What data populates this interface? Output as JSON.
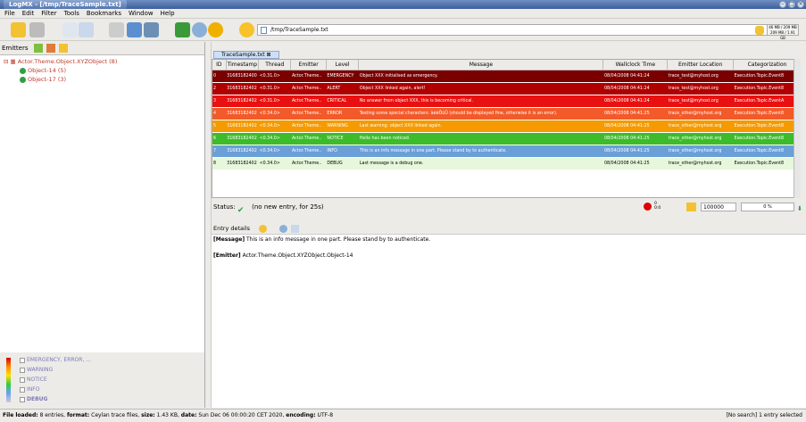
{
  "window": {
    "title": "LogMX - [/tmp/TraceSample.txt]"
  },
  "menu": [
    "File",
    "Edit",
    "Filter",
    "Tools",
    "Bookmarks",
    "Window",
    "Help"
  ],
  "toolbar": {
    "path": "/tmp/TraceSample.txt",
    "mem_used": "46 MB / 209 MB",
    "mem_total": "209 MB / 1.91 GB"
  },
  "emitters": {
    "label": "Emitters",
    "root": "Actor.Theme.Object.XYZObject (8)",
    "children": [
      "Object-14 (5)",
      "Object-17 (3)"
    ]
  },
  "levels": [
    "EMERGENCY, ERROR, ...",
    "WARNING",
    "NOTICE",
    "INFO",
    "DEBUG"
  ],
  "tab": {
    "label": "TraceSample.txt"
  },
  "table": {
    "columns": [
      "ID",
      "Timestamp",
      "Thread",
      "Emitter",
      "Level",
      "Message",
      "Wallclock Time",
      "Emitter Location",
      "Categorization"
    ],
    "rows": [
      {
        "id": "0",
        "ts": "31683182400",
        "thread": "<0.31.0>",
        "emitter": "Actor.Theme..",
        "level": "EMERGENCY",
        "msg": "Object XXX initialised as emergency.",
        "wall": "08/04/2008 04:41:24",
        "loc": "trace_test@myhost.org",
        "cat": "Execution.Topic.Event8",
        "bg": "#7a0000"
      },
      {
        "id": "2",
        "ts": "31683182402",
        "thread": "<0.31.0>",
        "emitter": "Actor.Theme..",
        "level": "ALERT",
        "msg": "Object XXX linked again, alert!",
        "wall": "08/04/2008 04:41:24",
        "loc": "trace_test@myhost.org",
        "cat": "Execution.Topic.Event8",
        "bg": "#b00000"
      },
      {
        "id": "3",
        "ts": "31683182402",
        "thread": "<0.31.0>",
        "emitter": "Actor.Theme..",
        "level": "CRITICAL",
        "msg": "No answer from object XXX, this is becoming critical.",
        "wall": "08/04/2008 04:41:24",
        "loc": "trace_test@myhost.org",
        "cat": "Execution.Topic.EventA",
        "bg": "#e81010"
      },
      {
        "id": "4",
        "ts": "31683182402",
        "thread": "<0.34.0>",
        "emitter": "Actor.Theme..",
        "level": "ERROR",
        "msg": "Testing some special characters: àéèÖüÜ (should be displayed fine, otherwise it is an error).",
        "wall": "08/04/2008 04:41:25",
        "loc": "trace_other@myhost.org",
        "cat": "Execution.Topic.Event8",
        "bg": "#f25a2a"
      },
      {
        "id": "5",
        "ts": "31683182402",
        "thread": "<0.34.0>",
        "emitter": "Actor.Theme..",
        "level": "WARNING",
        "msg": "Last warning: object XXX linked again.",
        "wall": "08/04/2008 04:41:25",
        "loc": "trace_other@myhost.org",
        "cat": "Execution.Topic.Event8",
        "bg": "#f59a00"
      },
      {
        "id": "6",
        "ts": "31683182402",
        "thread": "<0.34.0>",
        "emitter": "Actor.Theme..",
        "level": "NOTICE",
        "msg": "Hello has been noticed.",
        "wall": "08/04/2008 04:41:25",
        "loc": "trace_other@myhost.org",
        "cat": "Execution.Topic.Event8",
        "bg": "#3dbb2a"
      },
      {
        "id": "7",
        "ts": "31683182402",
        "thread": "<0.34.0>",
        "emitter": "Actor.Theme..",
        "level": "INFO",
        "msg": "This is an info message in one part. Please stand by to authenticate.",
        "wall": "08/04/2008 04:41:25",
        "loc": "trace_other@myhost.org",
        "cat": "Execution.Topic.Event8",
        "bg": "#6a9fd8"
      },
      {
        "id": "8",
        "ts": "31683182402",
        "thread": "<0.34.0>",
        "emitter": "Actor.Theme..",
        "level": "DEBUG",
        "msg": "Last message is a debug one.",
        "wall": "08/04/2008 04:41:25",
        "loc": "trace_other@myhost.org",
        "cat": "Execution.Topic.Event8",
        "bg": "#e6f7dc"
      }
    ]
  },
  "status": {
    "label": "Status:",
    "text": "(no new entry, for 25s)",
    "count_top": "0",
    "count_bot": "0:0",
    "limit": "100000",
    "percent": "0 %"
  },
  "details": {
    "header": "Entry details",
    "message_label": "[Message]",
    "message": "This is an info message in one part. Please stand by to authenticate.",
    "emitter_label": "[Emitter]",
    "emitter": "Actor.Theme.Object.XYZObject.Object-14"
  },
  "footer": {
    "loaded_label": "File loaded:",
    "loaded_val": "8 entries,",
    "format_label": "format:",
    "format_val": "Ceylan trace files,",
    "size_label": "size:",
    "size_val": "1.43 KB,",
    "date_label": "date:",
    "date_val": "Sun Dec 06 00:00:20 CET 2020,",
    "enc_label": "encoding:",
    "enc_val": "UTF-8",
    "right": "[No search]  1 entry selected"
  }
}
